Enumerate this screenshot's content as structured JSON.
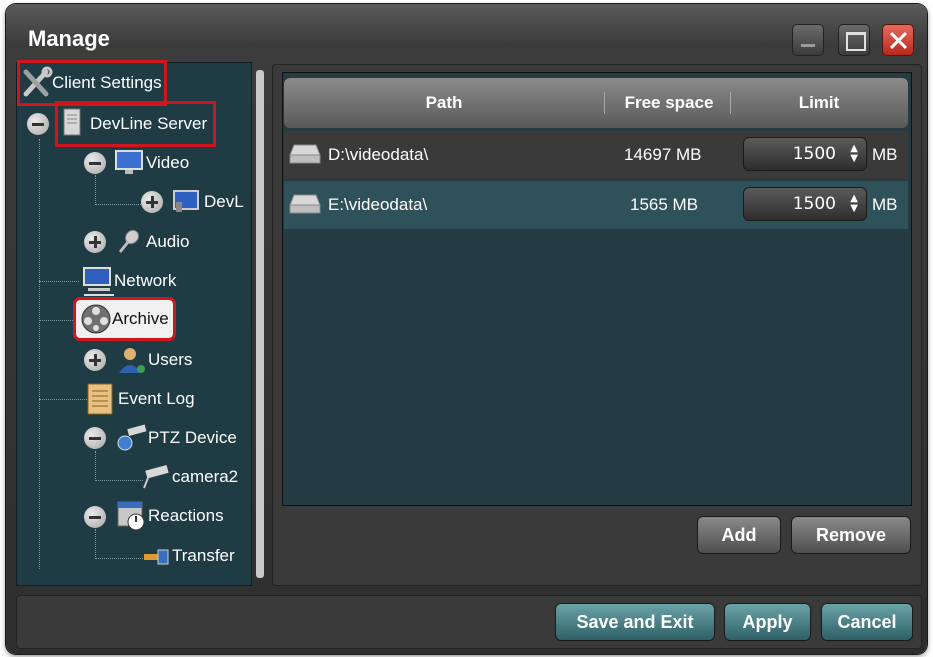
{
  "window": {
    "title": "Manage"
  },
  "tree": {
    "items": [
      {
        "label": "Client Settings",
        "icon": "tools-icon"
      },
      {
        "label": "DevLine Server",
        "icon": "server-icon"
      },
      {
        "label": "Video",
        "icon": "monitor-icon"
      },
      {
        "label": "DevL",
        "icon": "video-device-icon"
      },
      {
        "label": "Audio",
        "icon": "microphone-icon"
      },
      {
        "label": "Network",
        "icon": "network-icon"
      },
      {
        "label": "Archive",
        "icon": "film-reel-icon"
      },
      {
        "label": "Users",
        "icon": "user-icon"
      },
      {
        "label": "Event Log",
        "icon": "document-icon"
      },
      {
        "label": "PTZ Device",
        "icon": "ptz-camera-icon"
      },
      {
        "label": "camera2",
        "icon": "camera-icon"
      },
      {
        "label": "Reactions",
        "icon": "reactions-icon"
      },
      {
        "label": "Transfer",
        "icon": "transfer-icon"
      }
    ]
  },
  "table": {
    "headers": {
      "path": "Path",
      "free_space": "Free space",
      "limit": "Limit"
    },
    "rows": [
      {
        "path": "D:\\videodata\\",
        "free_space": "14697 MB",
        "limit": "1500",
        "unit": "MB"
      },
      {
        "path": "E:\\videodata\\",
        "free_space": "1565 MB",
        "limit": "1500",
        "unit": "MB"
      }
    ]
  },
  "buttons": {
    "add": "Add",
    "remove": "Remove",
    "save_exit": "Save and Exit",
    "apply": "Apply",
    "cancel": "Cancel"
  },
  "colors": {
    "highlight": "#d0161c",
    "tree_bg": "#1f3b44",
    "selected_row": "#2f5159"
  }
}
